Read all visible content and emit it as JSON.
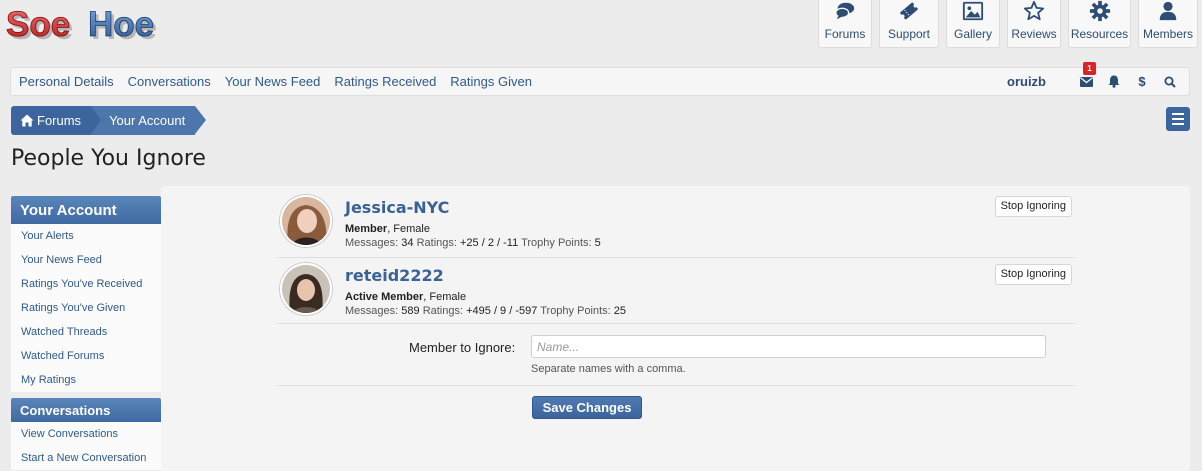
{
  "logo": {
    "text_part1": "Soe",
    "text_part2": "Hoe"
  },
  "top_nav": [
    {
      "label": "Forums",
      "icon": "chat-icon"
    },
    {
      "label": "Support",
      "icon": "ticket-icon"
    },
    {
      "label": "Gallery",
      "icon": "image-icon"
    },
    {
      "label": "Reviews",
      "icon": "star-icon"
    },
    {
      "label": "Resources",
      "icon": "gear-icon"
    },
    {
      "label": "Members",
      "icon": "user-icon"
    }
  ],
  "subnav": {
    "links": [
      "Personal Details",
      "Conversations",
      "Your News Feed",
      "Ratings Received",
      "Ratings Given"
    ],
    "username": "oruizb",
    "inbox_badge": "1"
  },
  "breadcrumb": {
    "home": "Forums",
    "current": "Your Account"
  },
  "page_title": "People You Ignore",
  "sidebar": {
    "account_heading": "Your Account",
    "account_items": [
      "Your Alerts",
      "Your News Feed",
      "Ratings You've Received",
      "Ratings You've Given",
      "Watched Threads",
      "Watched Forums",
      "My Ratings"
    ],
    "conversations_heading": "Conversations",
    "conversation_items": [
      "View Conversations",
      "Start a New Conversation"
    ]
  },
  "ignored": [
    {
      "name": "Jessica-NYC",
      "title_bold": "Member",
      "title_rest": ", Female",
      "messages_label": "Messages:",
      "messages": "34",
      "ratings_label": "Ratings:",
      "ratings": "+25 / 2 / -11",
      "trophy_label": "Trophy Points:",
      "trophy": "5",
      "button": "Stop Ignoring"
    },
    {
      "name": "reteid2222",
      "title_bold": "Active Member",
      "title_rest": ", Female",
      "messages_label": "Messages:",
      "messages": "589",
      "ratings_label": "Ratings:",
      "ratings": "+495 / 9 / -597",
      "trophy_label": "Trophy Points:",
      "trophy": "25",
      "button": "Stop Ignoring"
    }
  ],
  "form": {
    "label": "Member to Ignore:",
    "placeholder": "Name...",
    "hint": "Separate names with a comma.",
    "save": "Save Changes"
  },
  "colors": {
    "accent": "#3b659c",
    "link": "#2f5a8b",
    "badge": "#d9232a"
  }
}
